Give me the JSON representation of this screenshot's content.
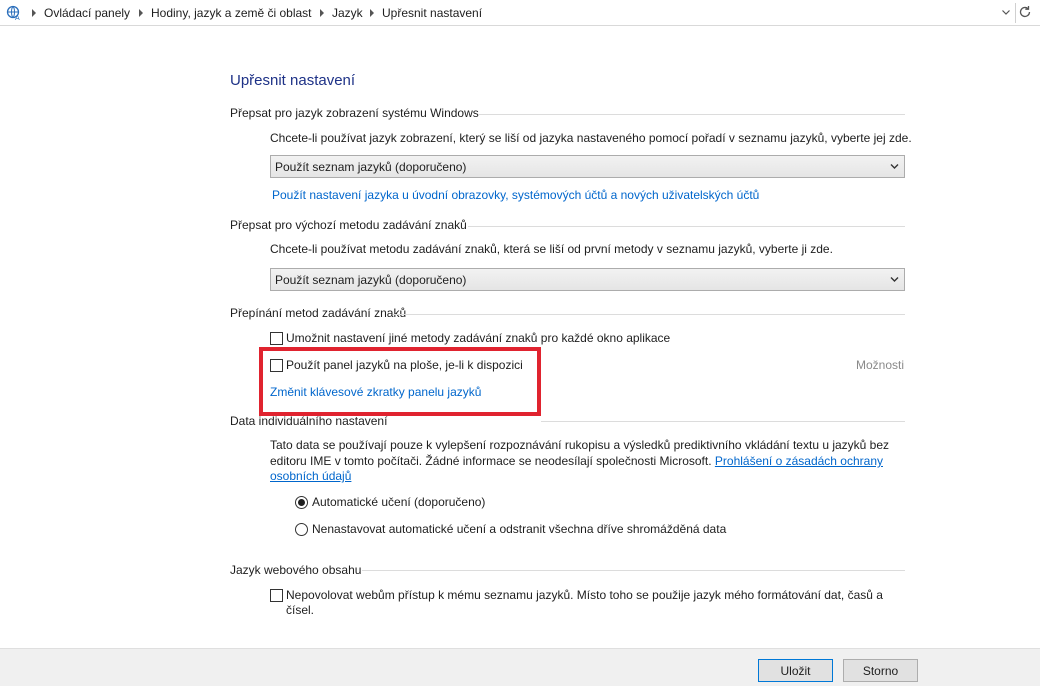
{
  "address_bar": {
    "breadcrumb": [
      "Ovládací panely",
      "Hodiny, jazyk a země či oblast",
      "Jazyk",
      "Upřesnit nastavení"
    ]
  },
  "page": {
    "title": "Upřesnit nastavení"
  },
  "display_language": {
    "heading": "Přepsat pro jazyk zobrazení systému Windows",
    "description": "Chcete-li používat jazyk zobrazení, který se liší od jazyka nastaveného pomocí pořadí v seznamu jazyků, vyberte jej zde.",
    "select_value": "Použít seznam jazyků (doporučeno)",
    "link": "Použít nastavení jazyka u úvodní obrazovky, systémových účtů a nových uživatelských účtů"
  },
  "input_method": {
    "heading": "Přepsat pro výchozí metodu zadávání znaků",
    "description": "Chcete-li používat metodu zadávání znaků, která se liší od první metody v seznamu jazyků, vyberte ji zde.",
    "select_value": "Použít seznam jazyků (doporučeno)"
  },
  "switching": {
    "heading": "Přepínání metod zadávání znaků",
    "checkbox1": {
      "label": "Umožnit nastavení jiné metody zadávání znaků pro každé okno aplikace",
      "checked": false
    },
    "checkbox2": {
      "label": "Použít panel jazyků na ploše, je-li k dispozici",
      "checked": false
    },
    "options_link": "Možnosti",
    "hotkeys_link": "Změnit klávesové zkratky panelu jazyků"
  },
  "personalization": {
    "heading": "Data individuálního nastavení",
    "text_line1": "Tato data se používají pouze k vylepšení rozpoznávání rukopisu a výsledků prediktivního vkládání textu u jazyků bez",
    "text_line2": "editoru IME v tomto počítači. Žádné informace se neodesílají společnosti Microsoft.",
    "privacy_link_part1": "Prohlášení o zásadách ochrany",
    "privacy_link_part2": "osobních údajů",
    "radio1": {
      "label": "Automatické učení (doporučeno)",
      "selected": true
    },
    "radio2": {
      "label": "Nenastavovat automatické učení a odstranit všechna dříve shromážděná data",
      "selected": false
    }
  },
  "web_content": {
    "heading": "Jazyk webového obsahu",
    "checkbox_line1": "Nepovolovat webům přístup k mému seznamu jazyků. Místo toho se použije jazyk mého formátování dat, časů a",
    "checkbox_line2": "čísel.",
    "checked": false
  },
  "footer": {
    "save_label": "Uložit",
    "cancel_label": "Storno"
  },
  "colors": {
    "title": "#1e3287",
    "link": "#0066cc",
    "highlight_box": "#e0232f"
  }
}
